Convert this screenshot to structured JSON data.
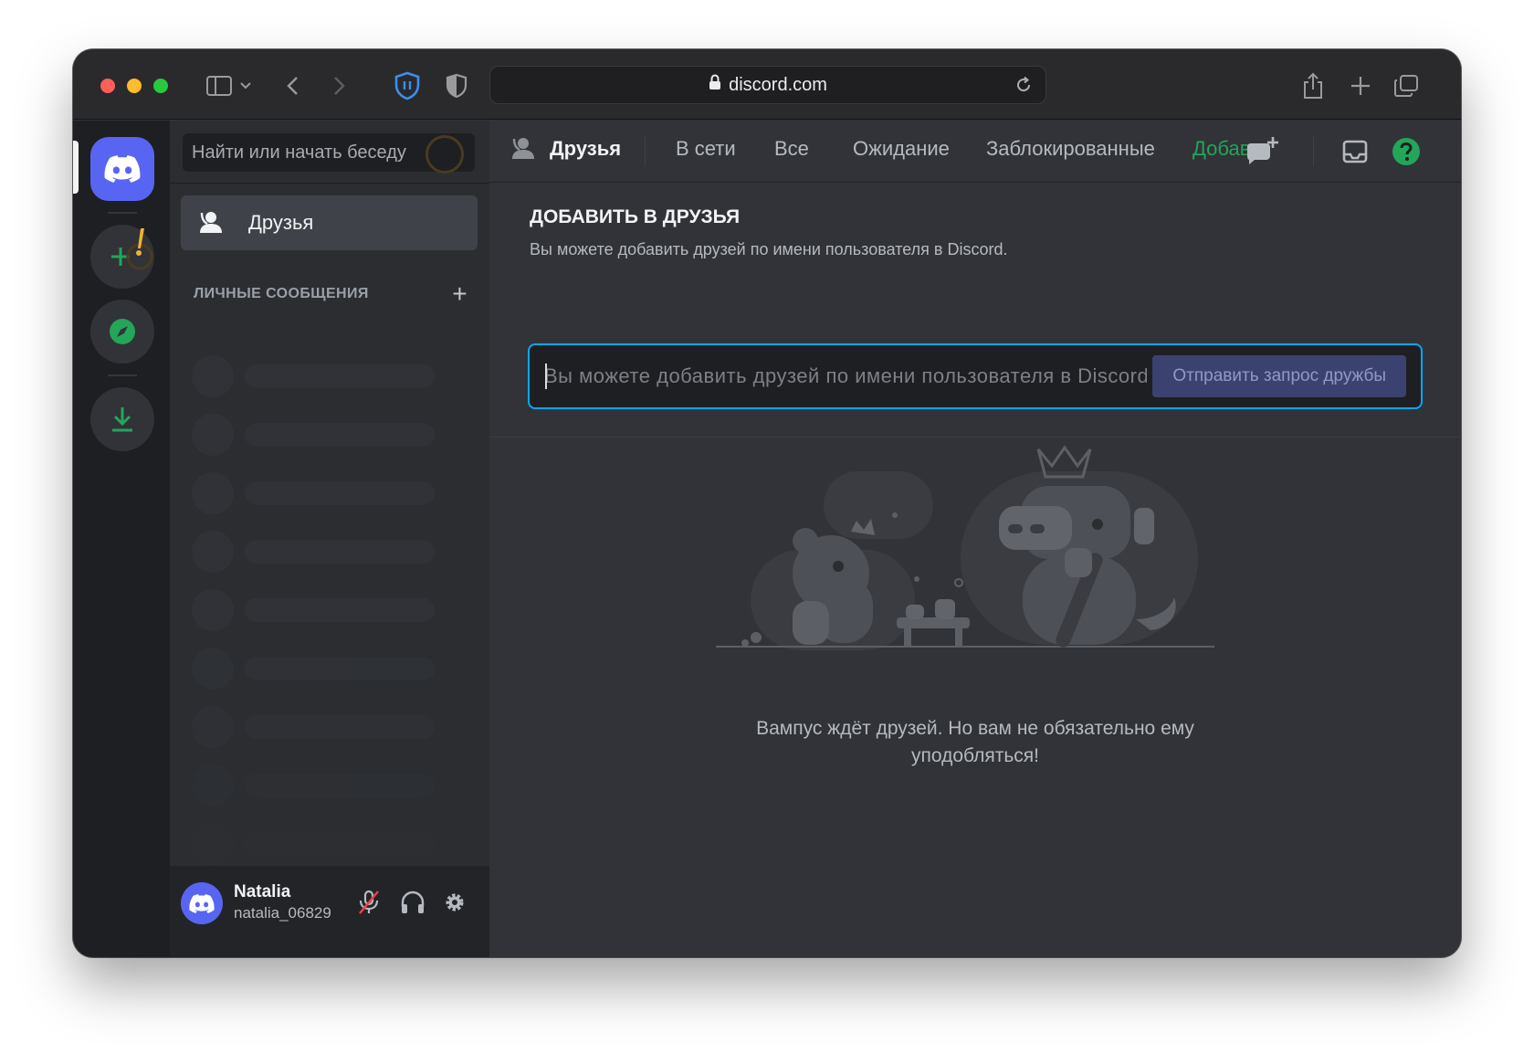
{
  "browser": {
    "url": "discord.com"
  },
  "sidebar": {
    "search_placeholder": "Найти или начать беседу",
    "friends_label": "Друзья",
    "dm_header": "ЛИЧНЫЕ СООБЩЕНИЯ",
    "dm_add": "+"
  },
  "user": {
    "name": "Natalia",
    "tag": "natalia_06829"
  },
  "topbar": {
    "friends": "Друзья",
    "online": "В сети",
    "all": "Все",
    "pending": "Ожидание",
    "blocked": "Заблокированные",
    "add_friend": "Добавить в друзья"
  },
  "add_friend": {
    "title": "ДОБАВИТЬ В ДРУЗЬЯ",
    "description": "Вы можете добавить друзей по имени пользователя в Discord.",
    "input_placeholder": "Вы можете добавить друзей по имени пользователя в Discord.",
    "button": "Отправить запрос дружбы"
  },
  "empty_state": {
    "line1": "Вампус ждёт друзей. Но вам не обязательно ему",
    "line2": "уподобляться!"
  },
  "colors": {
    "blurple": "#5865f2",
    "green": "#23a55a",
    "input_border": "#00a8fc"
  }
}
